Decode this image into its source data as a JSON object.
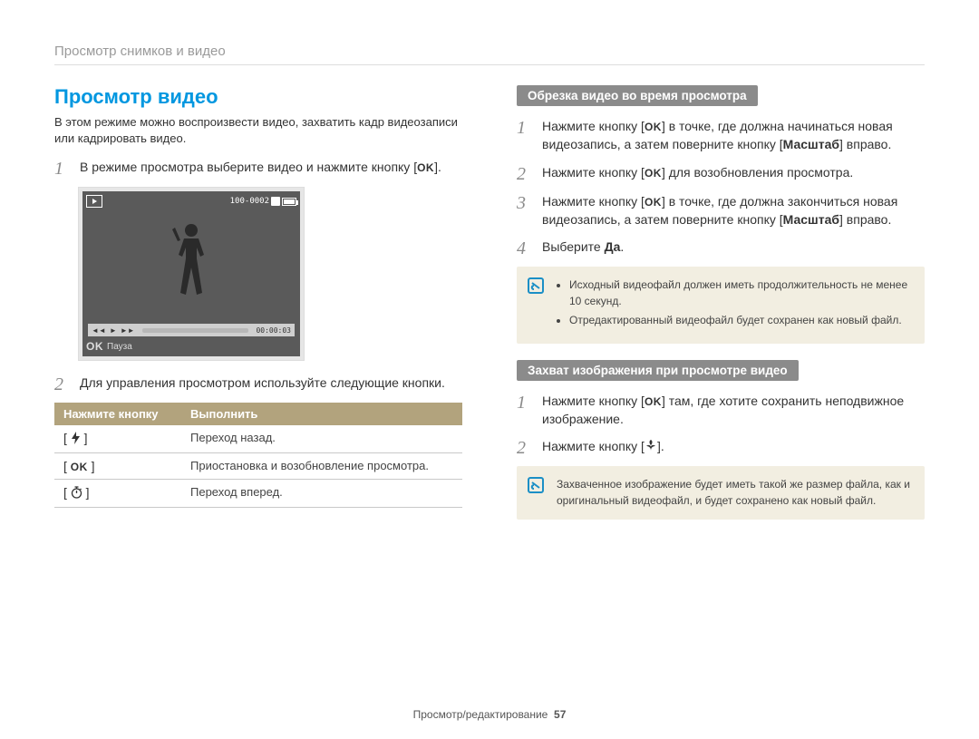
{
  "breadcrumb": "Просмотр снимков и видео",
  "left": {
    "title": "Просмотр видео",
    "intro": "В этом режиме можно воспроизвести видео, захватить кадр видеозаписи или кадрировать видео.",
    "step1_a": "В режиме просмотра выберите видео и нажмите кнопку [",
    "step1_ok": "OK",
    "step1_b": "].",
    "screenshot": {
      "file_counter": "100-0002",
      "time_elapsed": "00:00:03",
      "caption_ok": "OK",
      "caption_text": "Пауза"
    },
    "step2": "Для управления просмотром используйте следующие кнопки.",
    "table": {
      "head1": "Нажмите кнопку",
      "head2": "Выполнить",
      "rows": [
        {
          "key_prefix": "[ ",
          "icon": "flash",
          "key_suffix": " ]",
          "action": "Переход назад."
        },
        {
          "key_prefix": "[ ",
          "icon": "ok",
          "key_suffix": " ]",
          "action": "Приостановка и возобновление просмотра."
        },
        {
          "key_prefix": "[ ",
          "icon": "timer",
          "key_suffix": " ]",
          "action": "Переход вперед."
        }
      ]
    }
  },
  "right": {
    "trim": {
      "heading": "Обрезка видео во время просмотра",
      "step1_a": "Нажмите кнопку [",
      "step1_ok": "OK",
      "step1_b": "] в точке, где должна начинаться новая видеозапись, а затем поверните кнопку [",
      "step1_bold": "Масштаб",
      "step1_c": "] вправо.",
      "step2_a": "Нажмите кнопку [",
      "step2_ok": "OK",
      "step2_b": "] для возобновления просмотра.",
      "step3_a": "Нажмите кнопку [",
      "step3_ok": "OK",
      "step3_b": "] в точке, где должна закончиться новая видеозапись, а затем поверните кнопку [",
      "step3_bold": "Масштаб",
      "step3_c": "] вправо.",
      "step4_a": "Выберите ",
      "step4_bold": "Да",
      "step4_b": ".",
      "notes": [
        "Исходный видеофайл должен иметь продолжительность не менее 10 секунд.",
        "Отредактированный видеофайл будет сохранен как новый файл."
      ]
    },
    "capture": {
      "heading": "Захват изображения при просмотре видео",
      "step1_a": "Нажмите кнопку [",
      "step1_ok": "OK",
      "step1_b": "] там, где хотите сохранить неподвижное изображение.",
      "step2_a": "Нажмите кнопку [",
      "step2_icon": "macro",
      "step2_b": "].",
      "note": "Захваченное изображение будет иметь такой же размер файла, как и оригинальный видеофайл, и будет сохранено как новый файл."
    }
  },
  "footer": {
    "section": "Просмотр/редактирование",
    "page": "57"
  },
  "ok_text": "OK"
}
